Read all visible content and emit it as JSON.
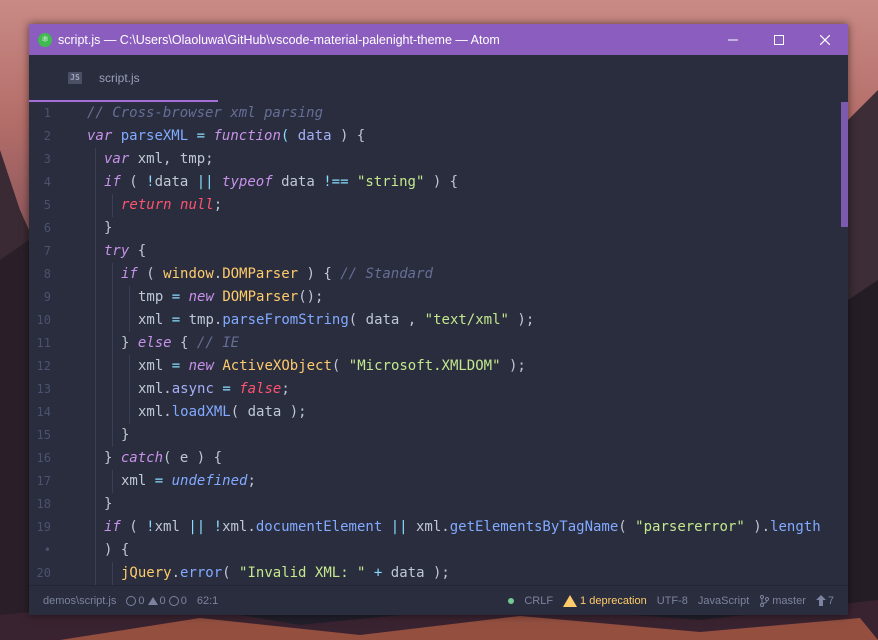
{
  "window": {
    "title": "script.js — C:\\Users\\Olaoluwa\\GitHub\\vscode-material-palenight-theme — Atom",
    "app_icon": "atom-icon"
  },
  "tabs": [
    {
      "label": "script.js",
      "icon": "js-file-icon",
      "active": true
    }
  ],
  "editor": {
    "lines": [
      {
        "n": "1"
      },
      {
        "n": "2"
      },
      {
        "n": "3"
      },
      {
        "n": "4"
      },
      {
        "n": "5"
      },
      {
        "n": "6"
      },
      {
        "n": "7"
      },
      {
        "n": "8"
      },
      {
        "n": "9"
      },
      {
        "n": "10"
      },
      {
        "n": "11"
      },
      {
        "n": "12"
      },
      {
        "n": "13"
      },
      {
        "n": "14"
      },
      {
        "n": "15"
      },
      {
        "n": "16"
      },
      {
        "n": "17"
      },
      {
        "n": "18"
      },
      {
        "n": "19"
      },
      {
        "n": "•"
      },
      {
        "n": "20"
      }
    ],
    "tokens": {
      "c1": "// Cross-browser xml parsing",
      "l2_var": "var",
      "l2_name": "parseXML",
      "l2_eq": "=",
      "l2_fn": "function",
      "l2_p1": "(",
      "l2_param": "data",
      "l2_rest": ") {",
      "l3_var": "var",
      "l3_rest": "xml, tmp;",
      "l4_if": "if",
      "l4_a": "( ",
      "l4_not": "!",
      "l4_data": "data",
      "l4_or": "||",
      "l4_typeof": "typeof",
      "l4_data2": "data",
      "l4_neq": "!==",
      "l4_str": "\"string\"",
      "l4_rest": ") {",
      "l5_ret": "return",
      "l5_null": "null",
      "l5_semi": ";",
      "l6": "}",
      "l7_try": "try",
      "l7_rest": "{",
      "l8_if": "if",
      "l8_a": "(",
      "l8_win": "window",
      "l8_dot": ".",
      "l8_dom": "DOMParser",
      "l8_b": ") {",
      "l8_cm": "// Standard",
      "l9_tmp": "tmp",
      "l9_eq": "=",
      "l9_new": "new",
      "l9_cls": "DOMParser",
      "l9_rest": "();",
      "l10_xml": "xml",
      "l10_eq": "=",
      "l10_tmp": "tmp",
      "l10_dot": ".",
      "l10_fn": "parseFromString",
      "l10_a": "( data ,",
      "l10_str": "\"text/xml\"",
      "l10_rest": ");",
      "l11_a": "}",
      "l11_else": "else",
      "l11_b": "{",
      "l11_cm": "// IE",
      "l12_xml": "xml",
      "l12_eq": "=",
      "l12_new": "new",
      "l12_cls": "ActiveXObject",
      "l12_a": "(",
      "l12_str": "\"Microsoft.XMLDOM\"",
      "l12_rest": ");",
      "l13_xml": "xml",
      "l13_dot": ".",
      "l13_prop": "async",
      "l13_eq": "=",
      "l13_false": "false",
      "l13_semi": ";",
      "l14_xml": "xml",
      "l14_dot": ".",
      "l14_fn": "loadXML",
      "l14_rest": "( data );",
      "l15": "}",
      "l16_a": "}",
      "l16_catch": "catch",
      "l16_rest": "( e ) {",
      "l17_xml": "xml",
      "l17_eq": "=",
      "l17_undef": "undefined",
      "l17_semi": ";",
      "l18": "}",
      "l19_if": "if",
      "l19_a": "(",
      "l19_not1": "!",
      "l19_xml1": "xml",
      "l19_or1": "||",
      "l19_not2": "!",
      "l19_xml2": "xml",
      "l19_dot1": ".",
      "l19_prop": "documentElement",
      "l19_or2": "||",
      "l19_xml3": "xml",
      "l19_dot2": ".",
      "l19_fn": "getElementsByTagName",
      "l19_b": "(",
      "l19_str": "\"parsererror\"",
      "l19_c": ")",
      "l19_dot3": ".",
      "l19_len": "length",
      "l19w": ") {",
      "l20_jq": "jQuery",
      "l20_dot": ".",
      "l20_fn": "error",
      "l20_a": "(",
      "l20_str": "\"Invalid XML: \"",
      "l20_plus": "+",
      "l20_rest": "data );"
    }
  },
  "status": {
    "path": "demos\\script.js",
    "errors": "0",
    "warnings": "0",
    "infos": "0",
    "cursor": "62:1",
    "line_ending": "CRLF",
    "deprecation": "1 deprecation",
    "encoding": "UTF-8",
    "grammar": "JavaScript",
    "branch": "master",
    "push_count": "7"
  },
  "colors": {
    "titlebar": "#8b5dbf",
    "editor_bg": "#292d3e",
    "accent": "#a270d8",
    "warning": "#ffcb6b"
  }
}
